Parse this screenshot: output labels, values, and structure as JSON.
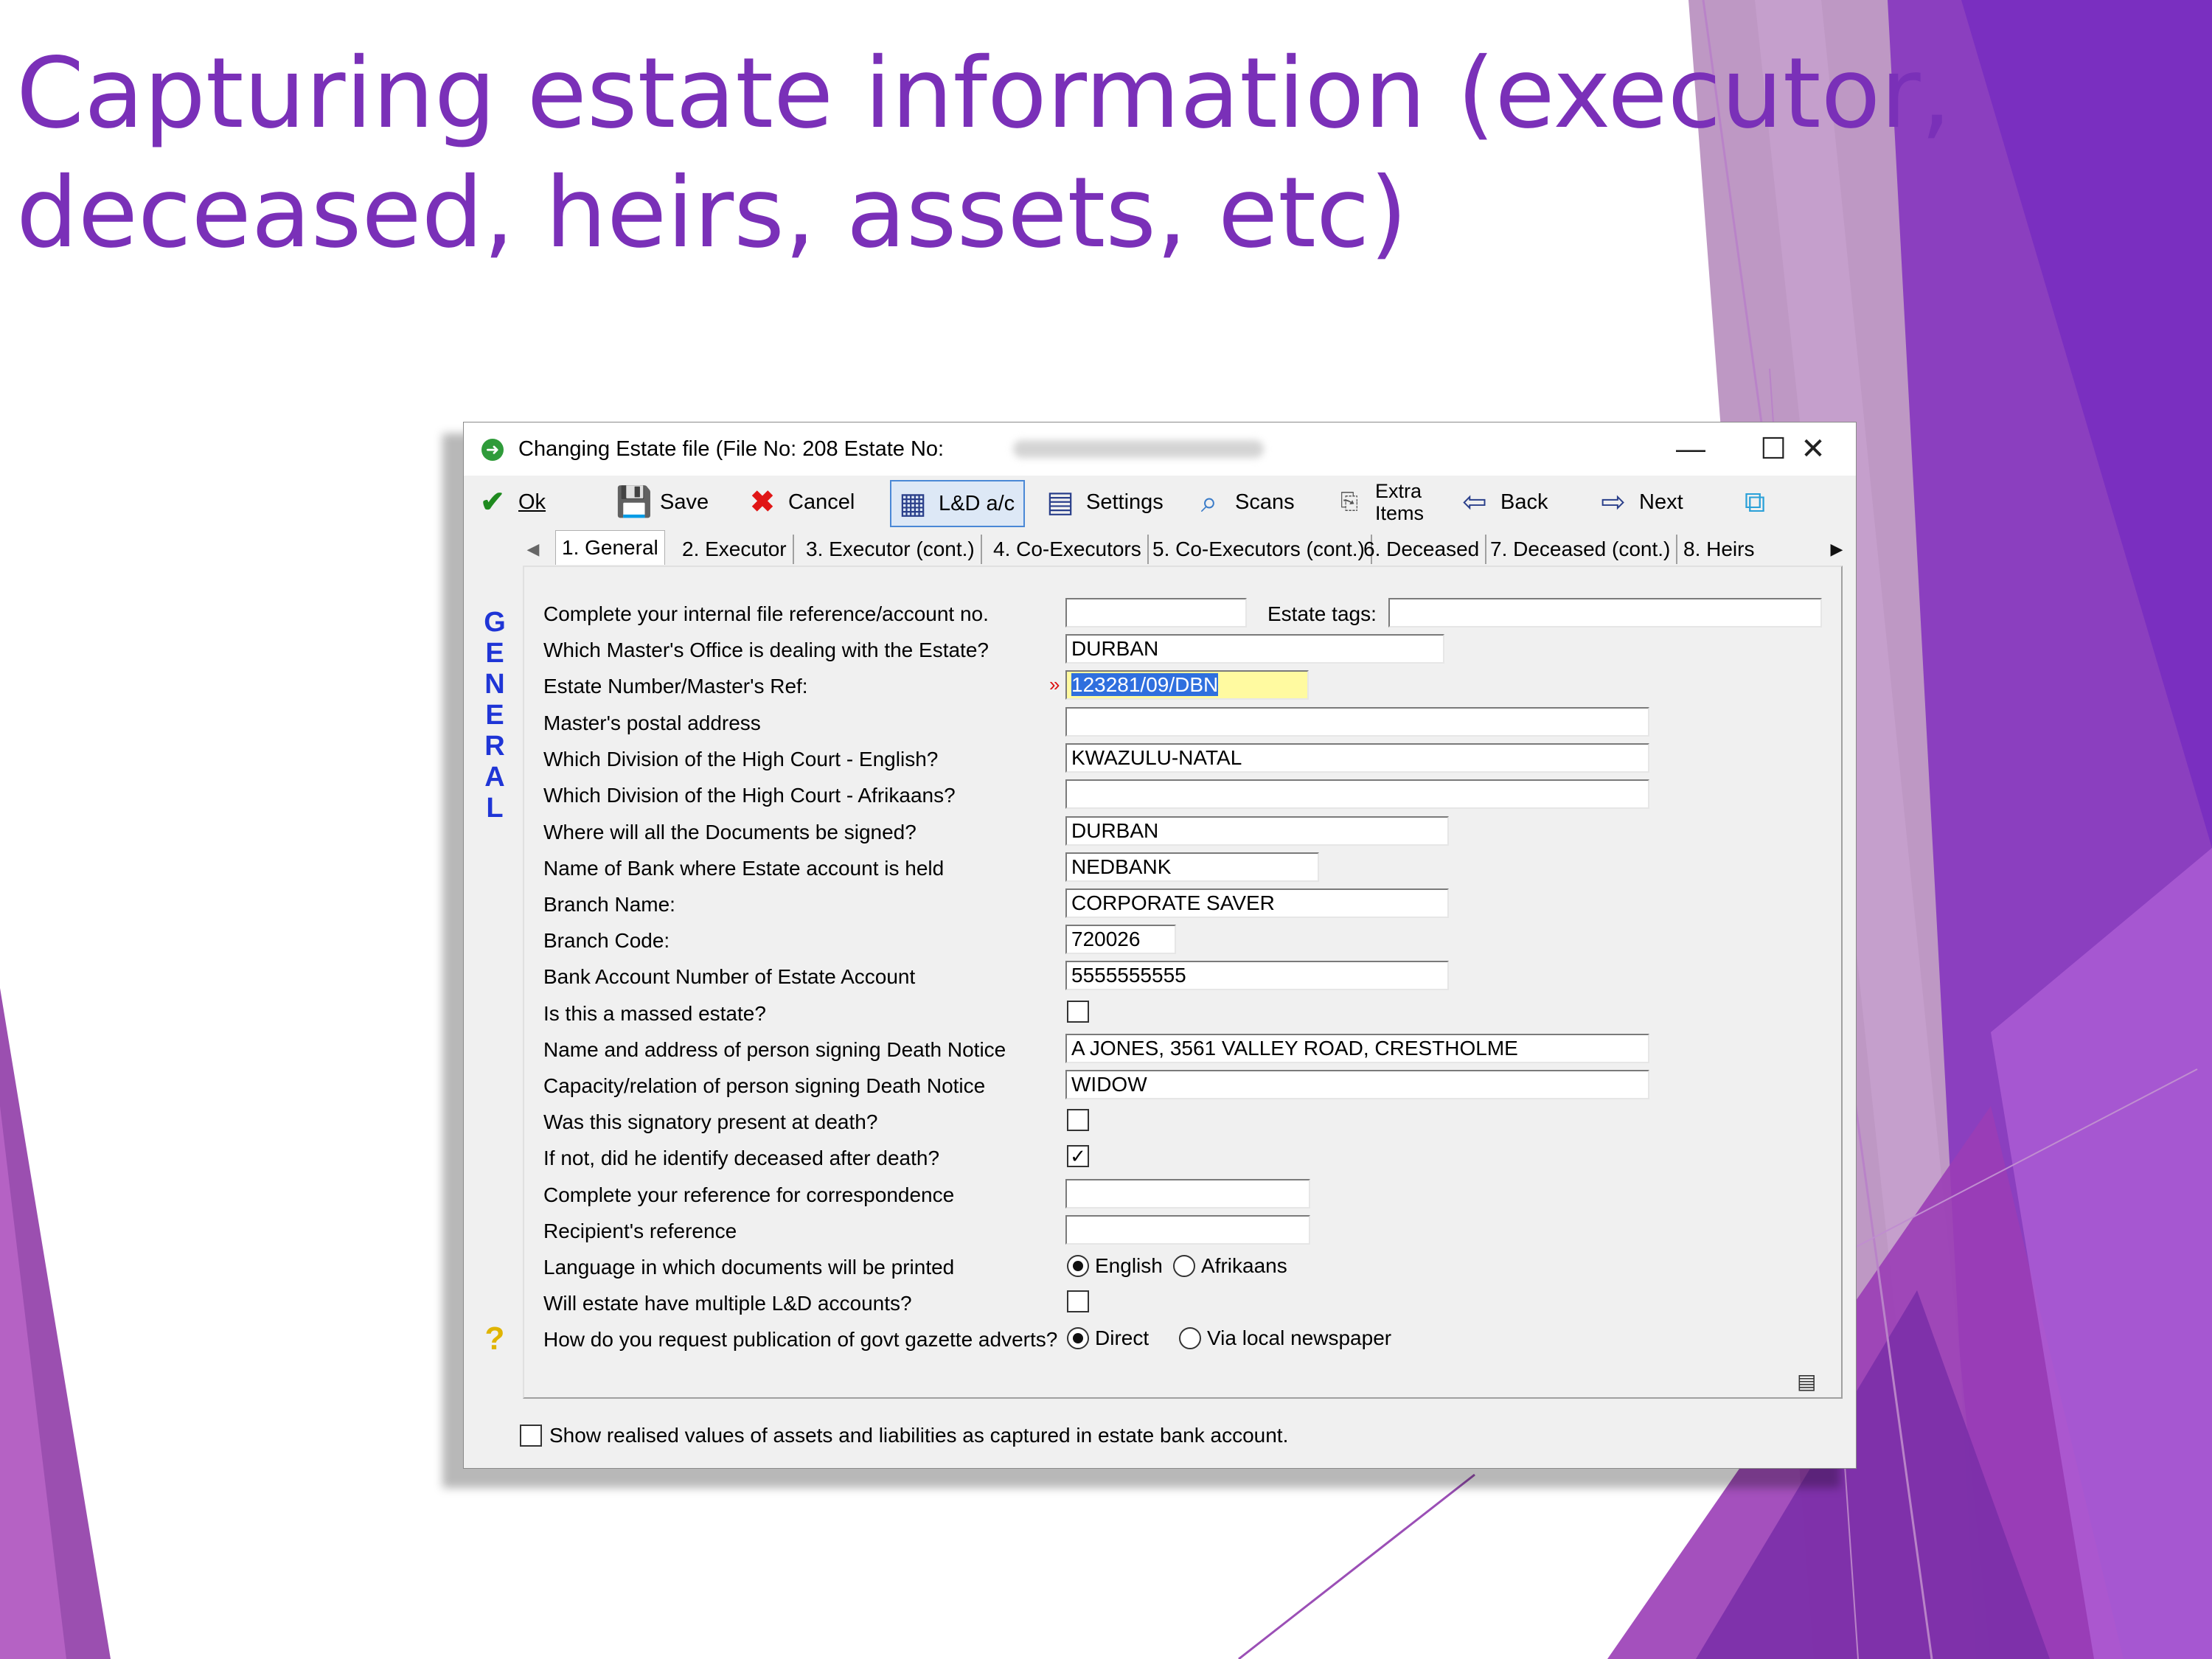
{
  "slide": {
    "title_line1": "Capturing estate information (executor,",
    "title_line2": "deceased, heirs, assets, etc)",
    "accent_color": "#7a30b8"
  },
  "window": {
    "title": "Changing Estate file  (File No: 208  Estate No:",
    "title_icon": "green-circle-arrow-icon",
    "minimize": "—",
    "maximize": "☐",
    "close": "✕"
  },
  "toolbar": {
    "ok": "Ok",
    "save": "Save",
    "cancel": "Cancel",
    "ld_ac": "L&D a/c",
    "settings": "Settings",
    "scans": "Scans",
    "extra_items_1": "Extra",
    "extra_items_2": "Items",
    "back": "Back",
    "next": "Next",
    "icons": [
      "checkmark-icon",
      "floppy-disk-icon",
      "red-x-icon",
      "calculator-icon",
      "settings-notepad-icon",
      "magnifier-icon",
      "extra-items-icon",
      "back-icon",
      "next-icon",
      "export-icon"
    ]
  },
  "tabs": [
    {
      "label": "1. General"
    },
    {
      "label": "2. Executor"
    },
    {
      "label": "3. Executor (cont.)"
    },
    {
      "label": "4. Co-Executors"
    },
    {
      "label": "5. Co-Executors (cont.)"
    },
    {
      "label": "6. Deceased"
    },
    {
      "label": "7. Deceased (cont.)"
    },
    {
      "label": "8. Heirs"
    }
  ],
  "vertical_label": [
    "G",
    "E",
    "N",
    "E",
    "R",
    "A",
    "L"
  ],
  "help": "?",
  "form": {
    "file_ref": {
      "label": "Complete your internal file reference/account no.",
      "value": ""
    },
    "estate_tags": {
      "label": "Estate tags:",
      "value": ""
    },
    "masters_office": {
      "label": "Which Master's Office is dealing with the Estate?",
      "value": "DURBAN"
    },
    "estate_number": {
      "label": "Estate Number/Master's Ref:",
      "value": "123281/09/DBN",
      "required_marker": "»"
    },
    "masters_postal": {
      "label": "Master's postal address",
      "value": ""
    },
    "high_court_en": {
      "label": "Which Division of the High Court - English?",
      "value": "KWAZULU-NATAL"
    },
    "high_court_af": {
      "label": "Which Division of the High Court - Afrikaans?",
      "value": ""
    },
    "docs_signed": {
      "label": "Where will all the Documents be signed?",
      "value": "DURBAN"
    },
    "bank_name": {
      "label": "Name of Bank where Estate account is held",
      "value": "NEDBANK"
    },
    "branch_name": {
      "label": "Branch Name:",
      "value": "CORPORATE SAVER"
    },
    "branch_code": {
      "label": "Branch Code:",
      "value": "720026"
    },
    "account_no": {
      "label": "Bank Account Number of Estate Account",
      "value": "5555555555"
    },
    "massed": {
      "label": "Is this a massed estate?",
      "checked": false
    },
    "signer_name": {
      "label": "Name and address of person signing Death Notice",
      "value": "A JONES, 3561 VALLEY ROAD, CRESTHOLME"
    },
    "signer_capacity": {
      "label": "Capacity/relation of person signing Death Notice",
      "value": "WIDOW"
    },
    "present_at_death": {
      "label": "Was this signatory present at death?",
      "checked": false
    },
    "identified": {
      "label": "If not, did he identify deceased after death?",
      "checked": true,
      "mark": "✓"
    },
    "corr_ref": {
      "label": "Complete your reference for correspondence",
      "value": ""
    },
    "recipient_ref": {
      "label": "Recipient's reference",
      "value": ""
    },
    "language": {
      "label": "Language in which documents will be printed",
      "opt1": "English",
      "opt2": "Afrikaans",
      "selected": "English"
    },
    "multi_ld": {
      "label": "Will estate have multiple L&D accounts?",
      "checked": false
    },
    "gazette": {
      "label": "How do you request publication of govt gazette adverts?",
      "opt1": "Direct",
      "opt2": "Via local newspaper",
      "selected": "Direct"
    }
  },
  "bottom_checkbox": {
    "label": "Show realised values of assets and liabilities as captured in estate bank account.",
    "checked": false
  }
}
